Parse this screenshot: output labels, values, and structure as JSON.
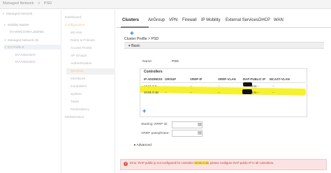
{
  "header": {
    "crumbs": [
      "Managed Network",
      "PSD"
    ]
  },
  "tree": {
    "items": [
      {
        "label": "Managed Network",
        "twisty": "▾"
      },
      {
        "label": "Mobility Master",
        "twisty": "▸"
      },
      {
        "label": "EV-WMCONM-LabMM1",
        "twisty": ""
      },
      {
        "label": "Managed Network (3)",
        "twisty": "▾"
      },
      {
        "label": "EV-Pralle-8",
        "twisty": "▾"
      },
      {
        "label": "EV-Arborsid-0",
        "twisty": ""
      },
      {
        "label": "EV-Arborsid-0",
        "twisty": ""
      }
    ]
  },
  "nav": {
    "items": [
      "Dashboard",
      "Configuration",
      "WLANs",
      "Roles & Policies",
      "Access Points",
      "AP Groups",
      "Authentication",
      "Services",
      "Interfaces",
      "Controllers",
      "System",
      "Tasks",
      "Redundancy",
      "Maintenance"
    ]
  },
  "tabs": [
    "Clusters",
    "AirGroup",
    "VPN",
    "Firewall",
    "IP Mobility",
    "External Services",
    "DHCP",
    "WAN"
  ],
  "profile": {
    "heading": "Cluster Profile > PSD",
    "basic_label": "Basic",
    "basic_twisty": "▾",
    "name_label": "Name:",
    "name_value": "PSD",
    "controllers_title": "Controllers",
    "columns": [
      "IP ADDRESS",
      "GROUP",
      "VRRP IP",
      "VRRP-VLAN",
      "RAP PUBLIC IP",
      "MCAST-VLAN"
    ],
    "rows": [
      {
        "ip": "10.81.0.9",
        "group": "--",
        "vrrp_ip": "--",
        "vrrp_vlan": "--",
        "rap": "244.--",
        "mcast": "--"
      },
      {
        "ip": "10.81.0.18",
        "group": "--",
        "vrrp_ip": "--",
        "vrrp_vlan": "--",
        "rap": "244.--",
        "mcast": "--"
      }
    ],
    "vrrp_id_label": "Starting VRRP ID:",
    "vrrp_pass_label": "VRRP passphrase:",
    "advanced_label": "Advanced",
    "advanced_twisty": "▸"
  },
  "error": {
    "icon": "!",
    "before": "Error: RAP public ip not configured for controller ",
    "ip": "10.81.0.18",
    "after": ", please configure RAP public IP in all controllers."
  },
  "colors": {
    "accent_blue": "#1a7bd5",
    "nav_orange": "#f2c59a",
    "highlight_yellow": "#f5f01c",
    "error_red": "#c24040"
  }
}
